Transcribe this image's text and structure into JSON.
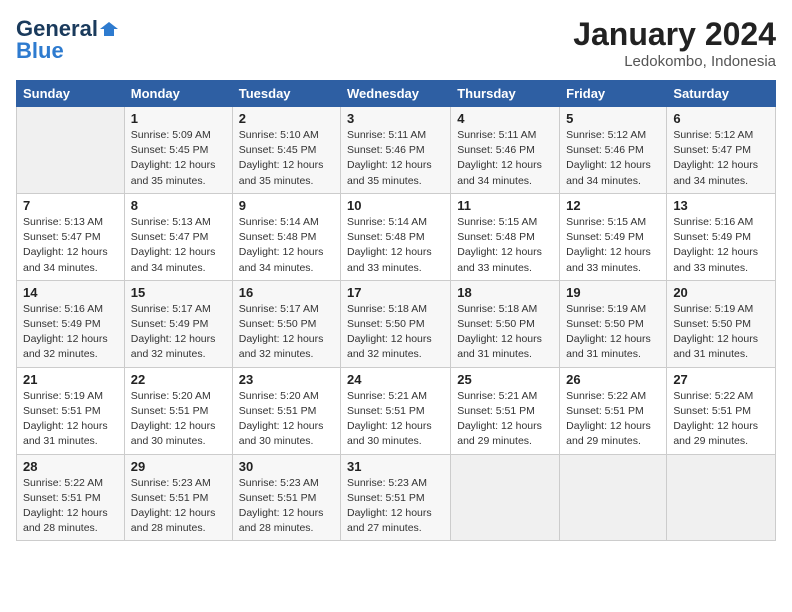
{
  "header": {
    "logo_line1": "General",
    "logo_line2": "Blue",
    "month_year": "January 2024",
    "location": "Ledokombo, Indonesia"
  },
  "weekdays": [
    "Sunday",
    "Monday",
    "Tuesday",
    "Wednesday",
    "Thursday",
    "Friday",
    "Saturday"
  ],
  "weeks": [
    [
      {
        "day": "",
        "info": ""
      },
      {
        "day": "1",
        "info": "Sunrise: 5:09 AM\nSunset: 5:45 PM\nDaylight: 12 hours\nand 35 minutes."
      },
      {
        "day": "2",
        "info": "Sunrise: 5:10 AM\nSunset: 5:45 PM\nDaylight: 12 hours\nand 35 minutes."
      },
      {
        "day": "3",
        "info": "Sunrise: 5:11 AM\nSunset: 5:46 PM\nDaylight: 12 hours\nand 35 minutes."
      },
      {
        "day": "4",
        "info": "Sunrise: 5:11 AM\nSunset: 5:46 PM\nDaylight: 12 hours\nand 34 minutes."
      },
      {
        "day": "5",
        "info": "Sunrise: 5:12 AM\nSunset: 5:46 PM\nDaylight: 12 hours\nand 34 minutes."
      },
      {
        "day": "6",
        "info": "Sunrise: 5:12 AM\nSunset: 5:47 PM\nDaylight: 12 hours\nand 34 minutes."
      }
    ],
    [
      {
        "day": "7",
        "info": "Sunrise: 5:13 AM\nSunset: 5:47 PM\nDaylight: 12 hours\nand 34 minutes."
      },
      {
        "day": "8",
        "info": "Sunrise: 5:13 AM\nSunset: 5:47 PM\nDaylight: 12 hours\nand 34 minutes."
      },
      {
        "day": "9",
        "info": "Sunrise: 5:14 AM\nSunset: 5:48 PM\nDaylight: 12 hours\nand 34 minutes."
      },
      {
        "day": "10",
        "info": "Sunrise: 5:14 AM\nSunset: 5:48 PM\nDaylight: 12 hours\nand 33 minutes."
      },
      {
        "day": "11",
        "info": "Sunrise: 5:15 AM\nSunset: 5:48 PM\nDaylight: 12 hours\nand 33 minutes."
      },
      {
        "day": "12",
        "info": "Sunrise: 5:15 AM\nSunset: 5:49 PM\nDaylight: 12 hours\nand 33 minutes."
      },
      {
        "day": "13",
        "info": "Sunrise: 5:16 AM\nSunset: 5:49 PM\nDaylight: 12 hours\nand 33 minutes."
      }
    ],
    [
      {
        "day": "14",
        "info": "Sunrise: 5:16 AM\nSunset: 5:49 PM\nDaylight: 12 hours\nand 32 minutes."
      },
      {
        "day": "15",
        "info": "Sunrise: 5:17 AM\nSunset: 5:49 PM\nDaylight: 12 hours\nand 32 minutes."
      },
      {
        "day": "16",
        "info": "Sunrise: 5:17 AM\nSunset: 5:50 PM\nDaylight: 12 hours\nand 32 minutes."
      },
      {
        "day": "17",
        "info": "Sunrise: 5:18 AM\nSunset: 5:50 PM\nDaylight: 12 hours\nand 32 minutes."
      },
      {
        "day": "18",
        "info": "Sunrise: 5:18 AM\nSunset: 5:50 PM\nDaylight: 12 hours\nand 31 minutes."
      },
      {
        "day": "19",
        "info": "Sunrise: 5:19 AM\nSunset: 5:50 PM\nDaylight: 12 hours\nand 31 minutes."
      },
      {
        "day": "20",
        "info": "Sunrise: 5:19 AM\nSunset: 5:50 PM\nDaylight: 12 hours\nand 31 minutes."
      }
    ],
    [
      {
        "day": "21",
        "info": "Sunrise: 5:19 AM\nSunset: 5:51 PM\nDaylight: 12 hours\nand 31 minutes."
      },
      {
        "day": "22",
        "info": "Sunrise: 5:20 AM\nSunset: 5:51 PM\nDaylight: 12 hours\nand 30 minutes."
      },
      {
        "day": "23",
        "info": "Sunrise: 5:20 AM\nSunset: 5:51 PM\nDaylight: 12 hours\nand 30 minutes."
      },
      {
        "day": "24",
        "info": "Sunrise: 5:21 AM\nSunset: 5:51 PM\nDaylight: 12 hours\nand 30 minutes."
      },
      {
        "day": "25",
        "info": "Sunrise: 5:21 AM\nSunset: 5:51 PM\nDaylight: 12 hours\nand 29 minutes."
      },
      {
        "day": "26",
        "info": "Sunrise: 5:22 AM\nSunset: 5:51 PM\nDaylight: 12 hours\nand 29 minutes."
      },
      {
        "day": "27",
        "info": "Sunrise: 5:22 AM\nSunset: 5:51 PM\nDaylight: 12 hours\nand 29 minutes."
      }
    ],
    [
      {
        "day": "28",
        "info": "Sunrise: 5:22 AM\nSunset: 5:51 PM\nDaylight: 12 hours\nand 28 minutes."
      },
      {
        "day": "29",
        "info": "Sunrise: 5:23 AM\nSunset: 5:51 PM\nDaylight: 12 hours\nand 28 minutes."
      },
      {
        "day": "30",
        "info": "Sunrise: 5:23 AM\nSunset: 5:51 PM\nDaylight: 12 hours\nand 28 minutes."
      },
      {
        "day": "31",
        "info": "Sunrise: 5:23 AM\nSunset: 5:51 PM\nDaylight: 12 hours\nand 27 minutes."
      },
      {
        "day": "",
        "info": ""
      },
      {
        "day": "",
        "info": ""
      },
      {
        "day": "",
        "info": ""
      }
    ]
  ]
}
